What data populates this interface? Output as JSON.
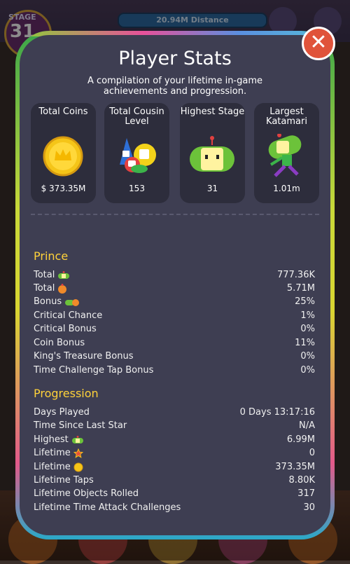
{
  "background": {
    "stage_label": "STAGE",
    "stage_number": "31",
    "distance": "20.94M Distance"
  },
  "header": {
    "title": "Player Stats",
    "subtitle": "A compilation of your lifetime in-game achievements and progression.",
    "close_label": "✕"
  },
  "cards": [
    {
      "title": "Total Coins",
      "value": "$ 373.35M",
      "icon": "gold-coin-icon"
    },
    {
      "title": "Total Cousin Level",
      "value": "153",
      "icon": "cousins-icon"
    },
    {
      "title": "Highest Stage",
      "value": "31",
      "icon": "prince-icon"
    },
    {
      "title": "Largest Katamari",
      "value": "1.01m",
      "icon": "rolling-prince-icon"
    }
  ],
  "prince": {
    "heading": "Prince",
    "rows": [
      {
        "label": "Total",
        "value": "777.36K",
        "icon": "green-prince-icon"
      },
      {
        "label": "Total",
        "value": "5.71M",
        "icon": "orange-prince-icon"
      },
      {
        "label": "Bonus",
        "value": "25%",
        "icon": "bonus-princes-icon"
      },
      {
        "label": "Critical Chance",
        "value": "1%"
      },
      {
        "label": "Critical Bonus",
        "value": "0%"
      },
      {
        "label": "Coin Bonus",
        "value": "11%"
      },
      {
        "label": "King's Treasure Bonus",
        "value": "0%"
      },
      {
        "label": "Time Challenge Tap Bonus",
        "value": "0%"
      }
    ]
  },
  "progression": {
    "heading": "Progression",
    "rows": [
      {
        "label": "Days Played",
        "value": "0 Days 13:17:16"
      },
      {
        "label": "Time Since Last Star",
        "value": "N/A"
      },
      {
        "label": "Highest",
        "value": "6.99M",
        "icon": "green-prince-icon"
      },
      {
        "label": "Lifetime",
        "value": "0",
        "icon": "star-icon"
      },
      {
        "label": "Lifetime",
        "value": "373.35M",
        "icon": "coin-icon"
      },
      {
        "label": "Lifetime Taps",
        "value": "8.80K"
      },
      {
        "label": "Lifetime Objects Rolled",
        "value": "317"
      },
      {
        "label": "Lifetime Time Attack Challenges",
        "value": "30"
      }
    ]
  }
}
